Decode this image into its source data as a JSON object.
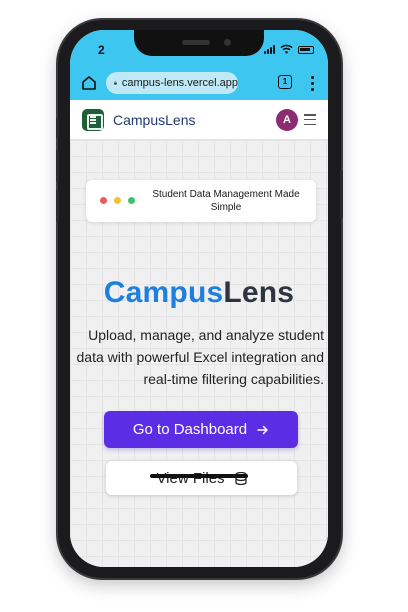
{
  "status": {
    "time": "2"
  },
  "browser": {
    "url": "campus-lens.vercel.app",
    "tabs_count": "1"
  },
  "app": {
    "name": "CampusLens",
    "avatar_initial": "A"
  },
  "hero": {
    "tagline": "Student Data Management Made Simple",
    "title_part1": "Campus",
    "title_part2": "Lens",
    "description": "Upload, manage, and analyze student data with powerful Excel integration and real-time filtering capabilities."
  },
  "actions": {
    "dashboard_label": "Go to Dashboard",
    "files_label": "View Files"
  },
  "colors": {
    "browser_bar": "#3dc6ef",
    "primary_button": "#5b2ee6",
    "title_blue": "#1d7fe0",
    "title_dark": "#2e3540",
    "avatar": "#8e2c72",
    "logo": "#1f5d3c",
    "dot_red": "#ef5b5b",
    "dot_yellow": "#f2c232",
    "dot_green": "#3fc36a"
  },
  "icons": [
    "home-icon",
    "lock-icon",
    "tabs-icon",
    "more-vert-icon",
    "logo-icon",
    "menu-icon",
    "arrow-right-icon",
    "database-icon"
  ]
}
